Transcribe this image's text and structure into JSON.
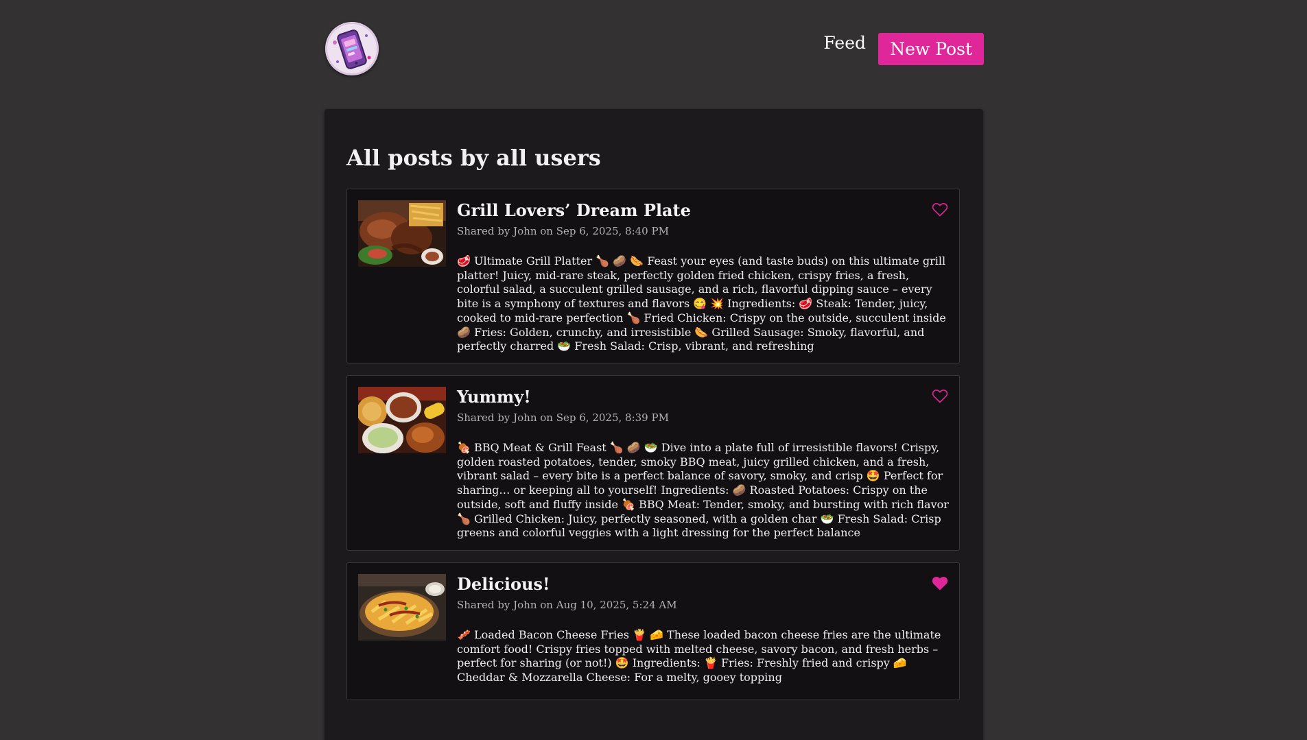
{
  "nav": {
    "feed_label": "Feed",
    "new_post_label": "New Post"
  },
  "colors": {
    "accent": "#e0279a",
    "background": "#343133",
    "card": "#1c1a1c",
    "post_card": "#121012"
  },
  "page": {
    "title": "All posts by all users"
  },
  "posts": [
    {
      "title": "Grill Lovers’ Dream Plate",
      "meta": "Shared by John on Sep 6, 2025, 8:40 PM",
      "body": "🥩 Ultimate Grill Platter 🍗 🥔 🌭 Feast your eyes (and taste buds) on this ultimate grill platter! Juicy, mid-rare steak, perfectly golden fried chicken, crispy fries, a fresh, colorful salad, a succulent grilled sausage, and a rich, flavorful dipping sauce – every bite is a symphony of textures and flavors 😋 💥 Ingredients: 🥩 Steak: Tender, juicy, cooked to mid-rare perfection 🍗 Fried Chicken: Crispy on the outside, succulent inside 🥔 Fries: Golden, crunchy, and irresistible 🌭 Grilled Sausage: Smoky, flavorful, and perfectly charred 🥗 Fresh Salad: Crisp, vibrant, and refreshing",
      "liked": false,
      "icon": "heart-outline-icon"
    },
    {
      "title": "Yummy!",
      "meta": "Shared by John on Sep 6, 2025, 8:39 PM",
      "body": "🍖 BBQ Meat & Grill Feast 🍗 🥔 🥗 Dive into a plate full of irresistible flavors! Crispy, golden roasted potatoes, tender, smoky BBQ meat, juicy grilled chicken, and a fresh, vibrant salad – every bite is a perfect balance of savory, smoky, and crisp 🤩 Perfect for sharing… or keeping all to yourself! Ingredients: 🥔 Roasted Potatoes: Crispy on the outside, soft and fluffy inside 🍖 BBQ Meat: Tender, smoky, and bursting with rich flavor 🍗 Grilled Chicken: Juicy, perfectly seasoned, with a golden char 🥗 Fresh Salad: Crisp greens and colorful veggies with a light dressing for the perfect balance",
      "liked": false,
      "icon": "heart-outline-icon"
    },
    {
      "title": "Delicious!",
      "meta": "Shared by John on Aug 10, 2025, 5:24 AM",
      "body": "🥓 Loaded Bacon Cheese Fries 🍟 🧀 These loaded bacon cheese fries are the ultimate comfort food! Crispy fries topped with melted cheese, savory bacon, and fresh herbs – perfect for sharing (or not!) 🤩 Ingredients: 🍟 Fries: Freshly fried and crispy 🧀 Cheddar & Mozzarella Cheese: For a melty, gooey topping",
      "liked": true,
      "icon": "heart-filled-icon"
    }
  ]
}
